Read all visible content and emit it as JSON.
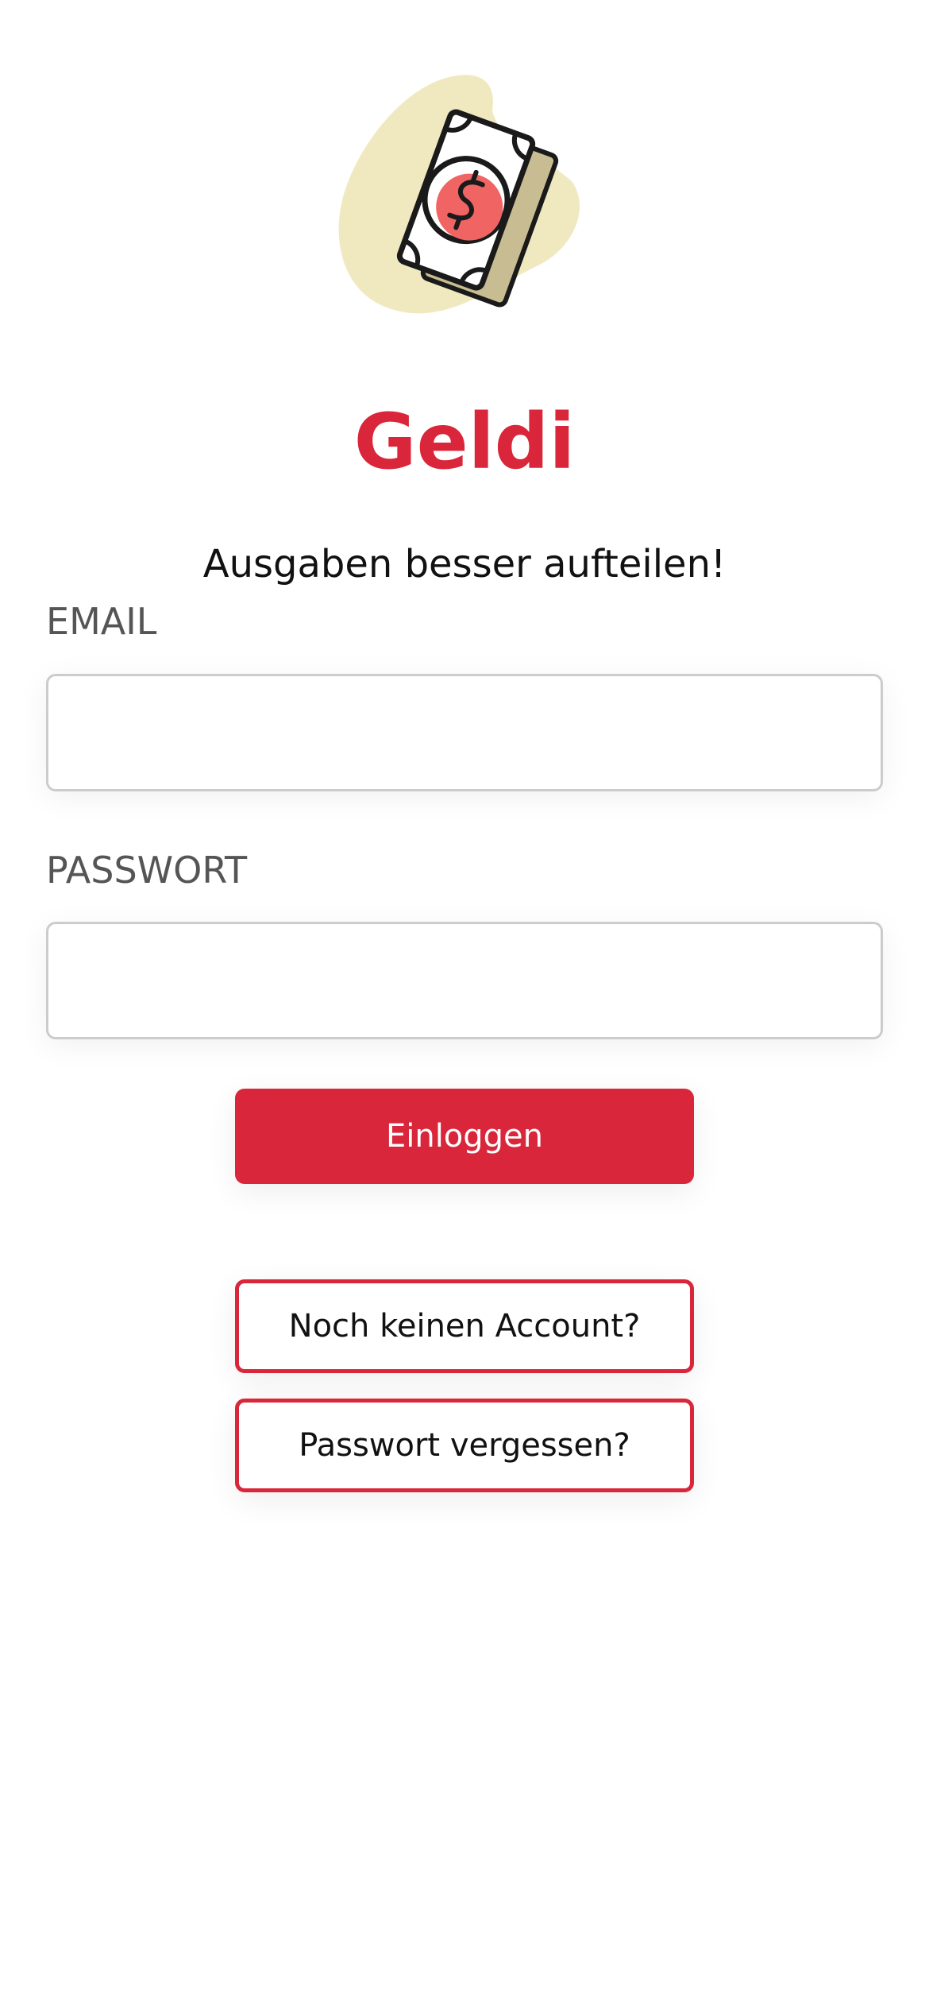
{
  "app": {
    "title": "Geldi",
    "tagline": "Ausgaben besser aufteilen!",
    "logo": "money-bill-icon"
  },
  "colors": {
    "brand": "#d9263a",
    "logo_blob": "#f0e9c0",
    "logo_coin": "#f06464"
  },
  "login_form": {
    "email_label": "EMAIL",
    "email_value": "",
    "password_label": "PASSWORT",
    "password_value": "",
    "submit_label": "Einloggen"
  },
  "links": {
    "register_label": "Noch keinen Account?",
    "forgot_password_label": "Passwort vergessen?"
  }
}
